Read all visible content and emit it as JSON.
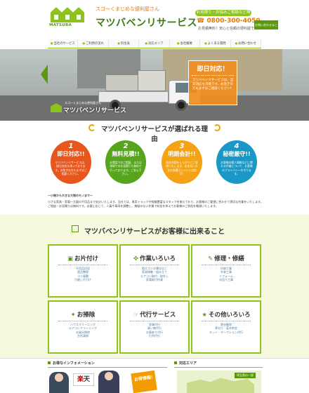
{
  "header": {
    "tagline": "スゴ～くまじめな便利屋さん",
    "logo_word": "MATSUBA",
    "brand": "マツバベンリサービス",
    "pill": "お見積り・お悩みご相談など無料、受付中!!",
    "phone": "0800-300-4050",
    "phone_sub": "お見積無料！安心と信頼の便利屋です",
    "form_button": "お問い合わせはこちら"
  },
  "nav": [
    {
      "label": "当社のサービス"
    },
    {
      "label": "ご利用の流れ"
    },
    {
      "label": "料金表"
    },
    {
      "label": "対応エリア"
    },
    {
      "label": "会社概要"
    },
    {
      "label": "よくある質問"
    },
    {
      "label": "お問い合わせ"
    }
  ],
  "hero": {
    "caption_small": "スゴ～くまじめな便利屋さん",
    "caption_big": "マツバベンリサービス",
    "callout_title": "即日対応！",
    "callout_body": "マツバベンリサービスは、当日対応も可能です。お急ぎの方もまずはご相談ください！"
  },
  "reasons": {
    "title": "マツバベンリサービスが選ばれる理由",
    "items": [
      {
        "num": "1",
        "title": "即日対応!!",
        "text": "マツバベンリサービスは、即日対応も承っております。お急ぎの方もまずはご相談ください。"
      },
      {
        "num": "2",
        "title": "無料見積!!",
        "text": "お電話でのご相談、または現場でのお見積りも無料で行っております。ご安心下さい。"
      },
      {
        "num": "3",
        "title": "明朗会計!!",
        "text": "料金内容をしっかりとご説明いたします。お支払い方法も各種クレジット対応可！"
      },
      {
        "num": "4",
        "title": "秘密厳守!!",
        "text": "お客様の個人情報などに関わる作業について、お客様のプライバシーを守ります。"
      }
    ]
  },
  "intro": {
    "heading": "～小物から大きな大物のモノまで～",
    "body": "小さな家具・家電～大量の不用品まで処分いたします。当社では、専用トラックや経験豊富なスタッフを揃えており、お客様のご要望に合わせて適切な作業をいたします。ご相談・お見積りは無料です。必要に応じて、人員や車両を調整し、無駄のない作業で料金を抑えてお客様のご負担を軽減いたします。"
  },
  "services": {
    "title": "マツバベンリサービスがお客様に出来ること",
    "cards": [
      {
        "title": "お片付け",
        "icon": "box-icon",
        "items": [
          "不用品回収",
          "遺品整理",
          "ゴミ屋敷",
          "引越し片付け"
        ]
      },
      {
        "title": "作業いろいろ",
        "icon": "tools-icon",
        "items": [
          "粗大ゴミの運び出し",
          "家具移動・組み立て",
          "エアコン取付・取外し",
          "家電取付作業"
        ]
      },
      {
        "title": "修理・修繕",
        "icon": "wrench-icon",
        "items": [
          "内装工事",
          "外装工事",
          "リフォーム",
          "水回り工事"
        ]
      },
      {
        "title": "お掃除",
        "icon": "broom-icon",
        "items": [
          "ハウスクリーニング",
          "エアコンクリーニング",
          "お風呂掃除",
          "台所清掃"
        ]
      },
      {
        "title": "代行サービス",
        "icon": "hand-icon",
        "items": [
          "家事代行",
          "買い物代行",
          "お墓参り代行",
          "行列代行"
        ]
      },
      {
        "title": "その他いろいろ",
        "icon": "star-icon",
        "items": [
          "害虫駆除",
          "草刈り・庭木剪定",
          "ネット・オークション代行"
        ]
      }
    ]
  },
  "footer": {
    "info_title": "お得なインフォメーション",
    "area_title": "対応エリア",
    "rakuten_a": "楽",
    "rakuten_b": "天",
    "otoku": "お得情報!",
    "map_label": "埼玉県の一部"
  },
  "colors": {
    "accent": "#8dc21f",
    "accent_dark": "#5a9a0a",
    "orange": "#f18d1e",
    "reason1": "#e8561c",
    "reason2": "#57a51d",
    "reason3": "#f4a316",
    "reason4": "#1b97c6"
  }
}
